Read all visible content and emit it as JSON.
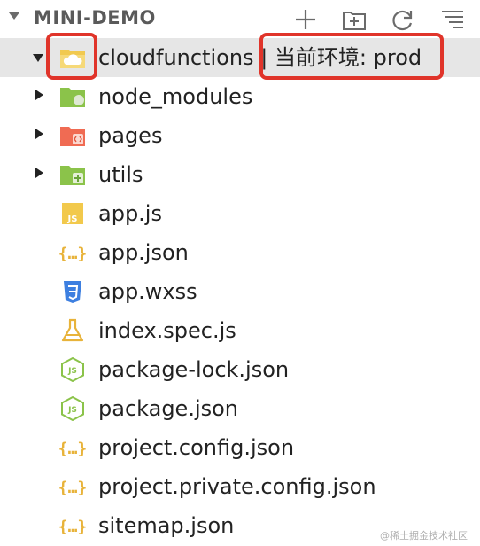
{
  "explorer": {
    "title": "MINI-DEMO",
    "toolbar": {
      "new_file": "new-file",
      "new_folder": "new-folder",
      "refresh": "refresh",
      "collapse": "collapse-all"
    }
  },
  "tree": {
    "root_folder": {
      "name": "cloudfunctions",
      "env_text": "| 当前环境: prod"
    },
    "folders": [
      "node_modules",
      "pages",
      "utils"
    ],
    "files": [
      "app.js",
      "app.json",
      "app.wxss",
      "index.spec.js",
      "package-lock.json",
      "package.json",
      "project.config.json",
      "project.private.config.json",
      "sitemap.json"
    ]
  },
  "watermark": "@稀土掘金技术社区",
  "colors": {
    "highlight": "#e0342a",
    "selected_row": "#e6e6e6",
    "folder_green": "#8bc34a",
    "folder_orange": "#f1c94f",
    "pages_folder": "#f06b53",
    "json_brace": "#e8b33a",
    "js_yellow": "#f2c94c",
    "css_blue": "#3d7fe0",
    "node_green": "#8bc34a"
  }
}
